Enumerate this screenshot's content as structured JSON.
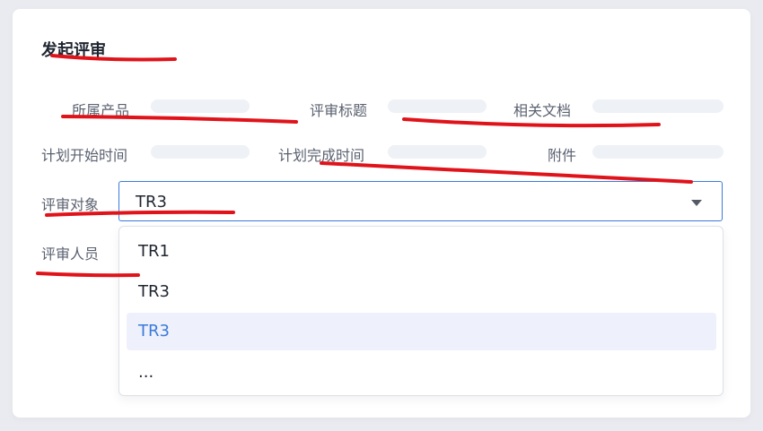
{
  "form": {
    "title": "发起评审",
    "fields": {
      "product": "所属产品",
      "review_title": "评审标题",
      "related_docs": "相关文档",
      "plan_start": "计划开始时间",
      "plan_finish": "计划完成时间",
      "attachment": "附件",
      "review_object": "评审对象",
      "reviewers": "评审人员"
    },
    "review_object_value": "TR3",
    "dropdown_options": [
      "TR1",
      "TR3",
      "TR3",
      "..."
    ],
    "highlighted_option_index": 2
  },
  "colors": {
    "accent": "#3b7bd9",
    "annotation": "#e0131a"
  },
  "icons": {
    "caret": "caret-down-icon"
  }
}
